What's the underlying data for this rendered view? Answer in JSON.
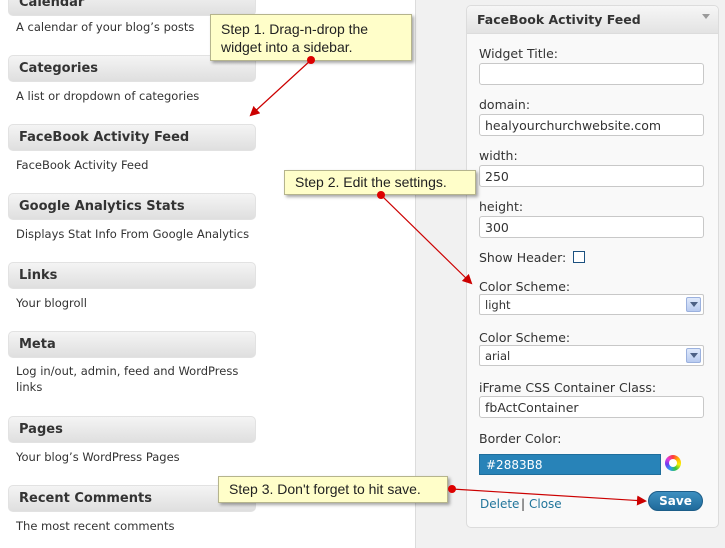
{
  "left_widgets": [
    {
      "title": "Calendar",
      "desc": "A calendar of your blog’s posts"
    },
    {
      "title": "Categories",
      "desc": "A list or dropdown of categories"
    },
    {
      "title": "FaceBook Activity Feed",
      "desc": "FaceBook Activity Feed"
    },
    {
      "title": "Google Analytics Stats",
      "desc": "Displays Stat Info From Google Analytics"
    },
    {
      "title": "Links",
      "desc": "Your blogroll"
    },
    {
      "title": "Meta",
      "desc": "Log in/out, admin, feed and WordPress links"
    },
    {
      "title": "Pages",
      "desc": "Your blog’s WordPress Pages"
    },
    {
      "title": "Recent Comments",
      "desc": "The most recent comments"
    }
  ],
  "panel": {
    "title": "FaceBook Activity Feed",
    "widget_title_label": "Widget Title:",
    "widget_title_value": "",
    "domain_label": "domain:",
    "domain_value": "healyourchurchwebsite.com",
    "width_label": "width:",
    "width_value": "250",
    "height_label": "height:",
    "height_value": "300",
    "show_header_label": "Show Header:",
    "color_scheme_label": "Color Scheme:",
    "color_scheme_value": "light",
    "font_label": "Color Scheme:",
    "font_value": "arial",
    "css_class_label": "iFrame CSS Container Class:",
    "css_class_value": "fbActContainer",
    "border_color_label": "Border Color:",
    "border_color_value": "#2883B8",
    "delete_label": "Delete",
    "separator": "|",
    "close_label": "Close",
    "save_label": "Save"
  },
  "notes": {
    "step1": "Step 1. Drag-n-drop the widget into a sidebar.",
    "step2": "Step 2. Edit the settings.",
    "step3": "Step 3. Don't forget to hit save."
  },
  "colors": {
    "accent": "#21759b",
    "border_color_swatch": "#2883b8",
    "note_bg": "#fffec9",
    "arrow": "#cc0000"
  }
}
